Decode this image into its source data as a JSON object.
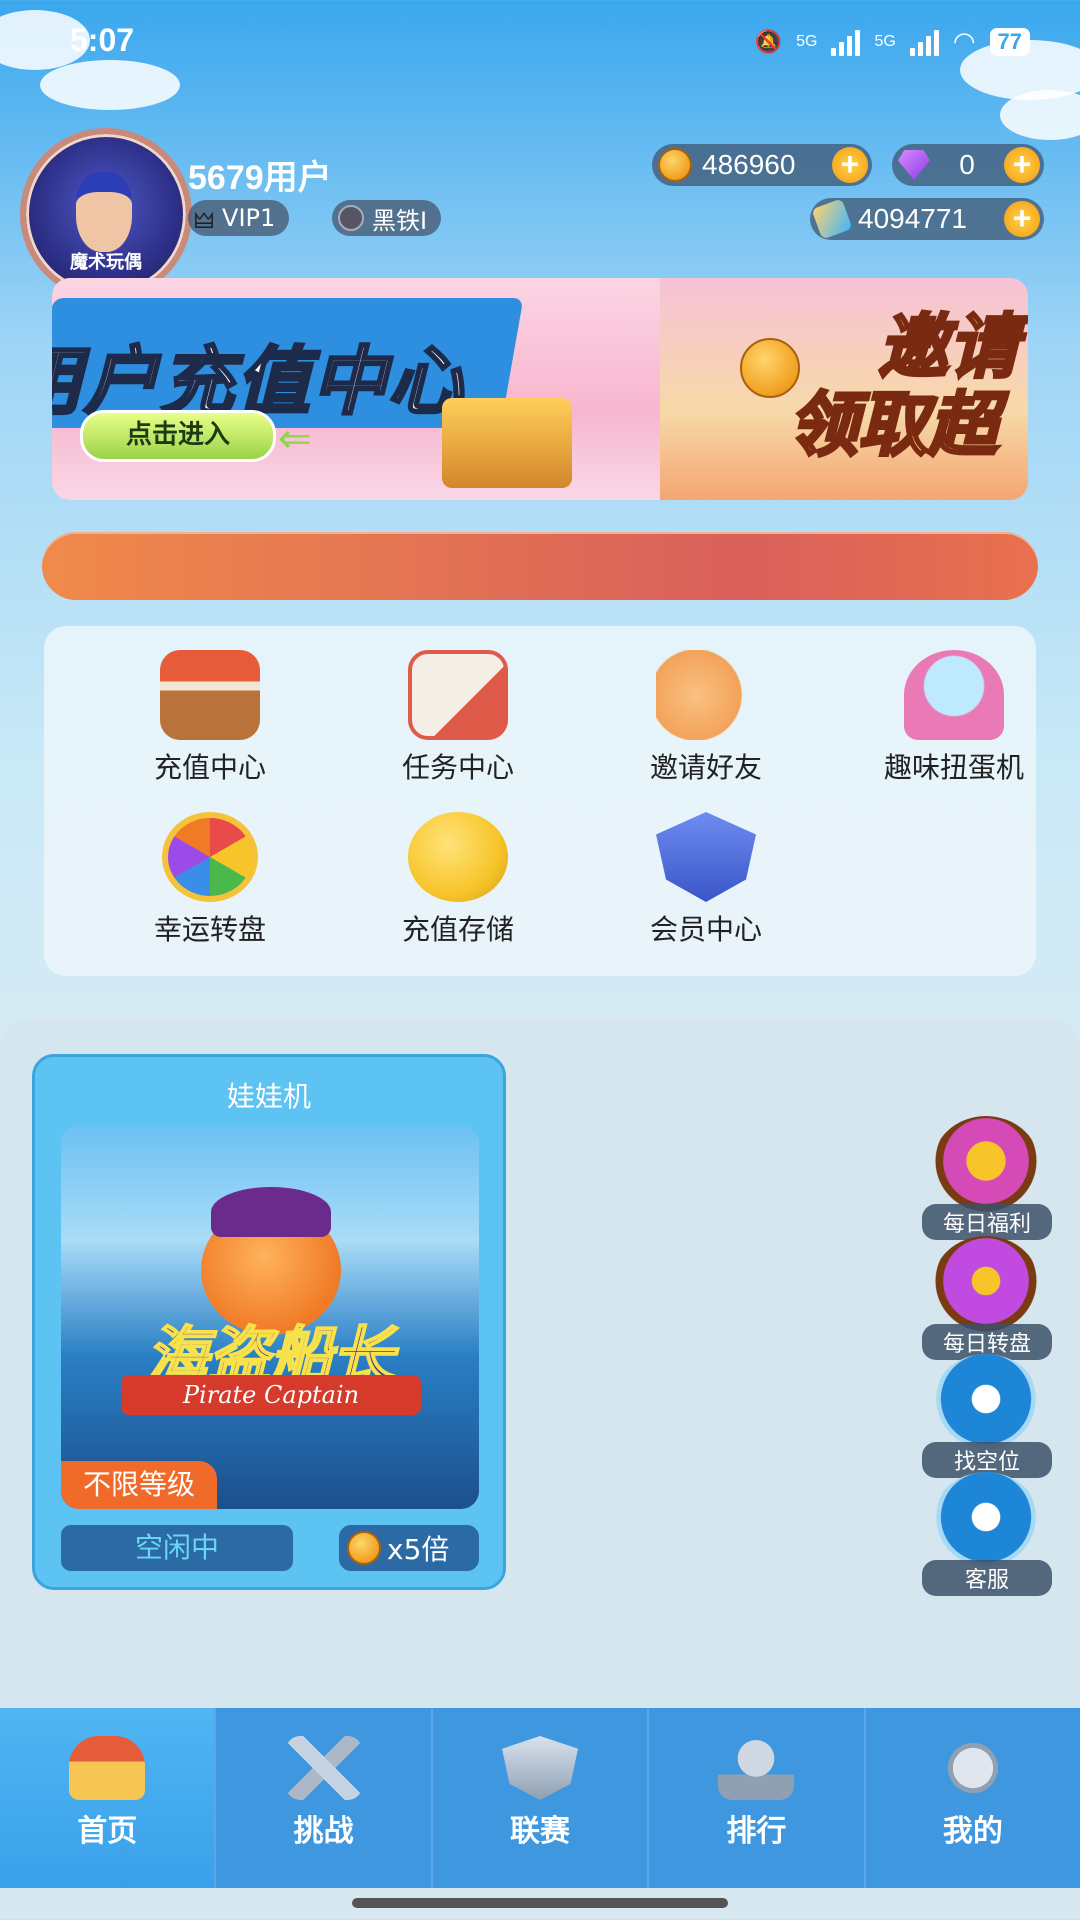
{
  "status_bar": {
    "time": "5:07",
    "net1": "5G",
    "net2": "5G",
    "battery": "77"
  },
  "profile": {
    "username": "5679用户",
    "avatar_text": "魔术玩偶",
    "vip": "VIP1",
    "rank": "黑铁I"
  },
  "resources": {
    "coins": "486960",
    "gems": "0",
    "tickets": "4094771"
  },
  "banner": {
    "title": "用户充值中心",
    "button": "点击进入",
    "right_text_line1": "邀请",
    "right_text_line2": "领取超"
  },
  "features": [
    {
      "label": "充值中心",
      "icon": "shop-stall-icon",
      "color": "#d8844a"
    },
    {
      "label": "任务中心",
      "icon": "clipboard-icon",
      "color": "#e05a4a"
    },
    {
      "label": "邀请好友",
      "icon": "high-five-icon",
      "color": "#f3a35a"
    },
    {
      "label": "趣味扭蛋机",
      "icon": "gashapon-icon",
      "color": "#e97ab6"
    },
    {
      "label": "幸运转盘",
      "icon": "lucky-wheel-icon",
      "color": "#f5c339"
    },
    {
      "label": "充值存储",
      "icon": "piggy-bank-icon",
      "color": "#f7c52a"
    },
    {
      "label": "会员中心",
      "icon": "vip-shield-icon",
      "color": "#4a6bd8"
    }
  ],
  "game_card": {
    "title": "娃娃机",
    "game_name": "海盗船长",
    "game_name_en": "Pirate Captain",
    "level_tag": "不限等级",
    "status": "空闲中",
    "multiplier": "x5倍"
  },
  "side_buttons": [
    {
      "label": "每日福利",
      "icon": "gift-icon"
    },
    {
      "label": "每日转盘",
      "icon": "daily-wheel-icon"
    },
    {
      "label": "找空位",
      "icon": "sofa-icon"
    },
    {
      "label": "客服",
      "icon": "headset-icon"
    }
  ],
  "bottom_nav": [
    {
      "label": "首页",
      "icon": "home-shop-icon",
      "active": true
    },
    {
      "label": "挑战",
      "icon": "crossed-swords-icon",
      "active": false
    },
    {
      "label": "联赛",
      "icon": "shield-badge-icon",
      "active": false
    },
    {
      "label": "排行",
      "icon": "trophy-icon",
      "active": false
    },
    {
      "label": "我的",
      "icon": "character-icon",
      "active": false
    }
  ]
}
